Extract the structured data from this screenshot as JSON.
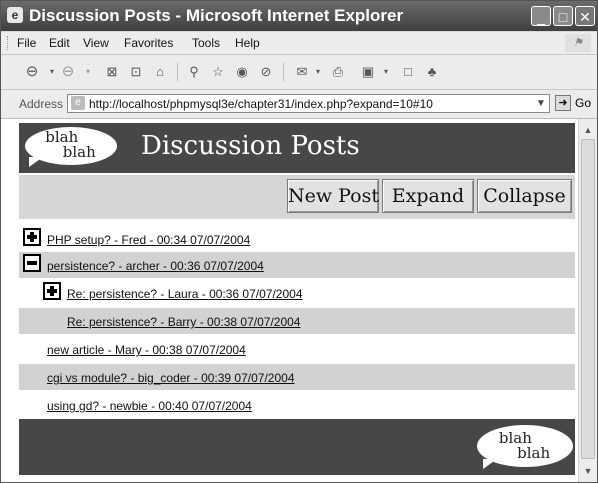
{
  "window": {
    "title": "Discussion Posts - Microsoft Internet Explorer",
    "icon": "ie-icon",
    "minimize": "_",
    "maximize": "□",
    "close": "✕"
  },
  "menu": [
    "File",
    "Edit",
    "View",
    "Favorites",
    "Tools",
    "Help"
  ],
  "toolbar": [
    "back-icon",
    "forward-icon",
    "stop-icon",
    "refresh-icon",
    "home-icon",
    "search-icon",
    "favorites-icon",
    "media-icon",
    "history-icon",
    "mail-icon",
    "print-icon",
    "edit-icon",
    "discuss-icon",
    "messenger-icon"
  ],
  "address": {
    "label": "Address",
    "url": "http://localhost/phpmysql3e/chapter31/index.php?expand=10#10",
    "go_label": "Go"
  },
  "page": {
    "logo_line1": "blah",
    "logo_line2": "blah",
    "title": "Discussion Posts",
    "buttons": {
      "new_post": "New Post",
      "expand": "Expand",
      "collapse": "Collapse"
    },
    "posts": [
      {
        "text": "PHP setup? - Fred - 00:34 07/07/2004",
        "toggle": "plus",
        "indent": 0,
        "shaded": false
      },
      {
        "text": "persistence? - archer - 00:36 07/07/2004",
        "toggle": "minus",
        "indent": 0,
        "shaded": true
      },
      {
        "text": "Re: persistence? - Laura - 00:36 07/07/2004",
        "toggle": "plus",
        "indent": 1,
        "shaded": false
      },
      {
        "text": "Re: persistence? - Barry - 00:38 07/07/2004",
        "toggle": "none",
        "indent": 1,
        "shaded": true
      },
      {
        "text": "new article - Mary - 00:38 07/07/2004",
        "toggle": "none",
        "indent": 0,
        "shaded": false
      },
      {
        "text": "cgi vs module? - big_coder - 00:39 07/07/2004",
        "toggle": "none",
        "indent": 0,
        "shaded": true
      },
      {
        "text": "using gd? - newbie - 00:40 07/07/2004",
        "toggle": "none",
        "indent": 0,
        "shaded": false
      }
    ]
  }
}
